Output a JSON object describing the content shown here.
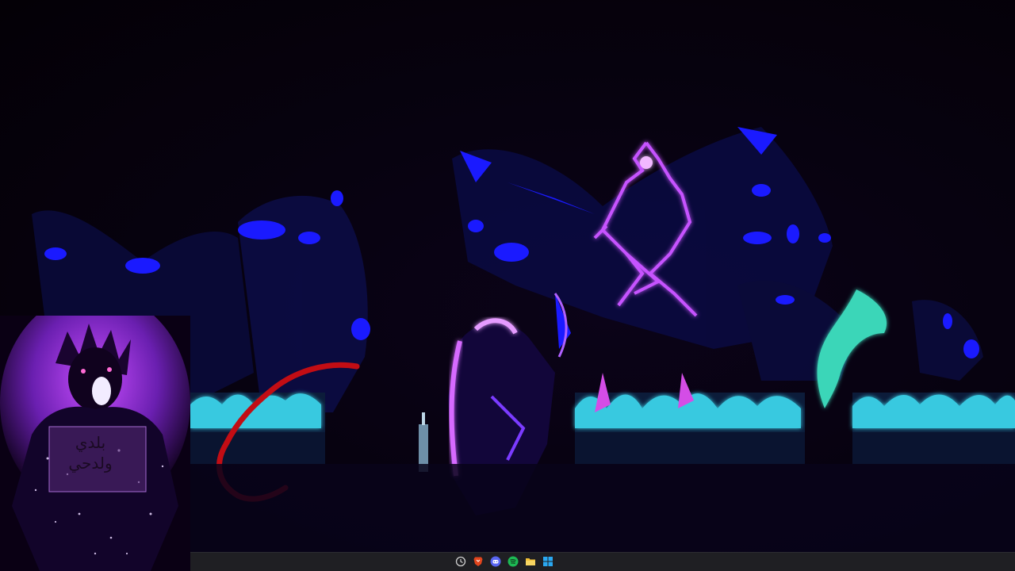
{
  "overlay": {
    "sign_line_1": "بلدي",
    "sign_line_2": "ولدحي"
  },
  "taskbar": {
    "apps": [
      {
        "name": "clock-app",
        "icon": "clock-icon",
        "color": "#cfcfcf"
      },
      {
        "name": "brave-browser",
        "icon": "brave-lion-icon",
        "color": "#e2451d"
      },
      {
        "name": "discord",
        "icon": "discord-icon",
        "color": "#5865f2"
      },
      {
        "name": "spotify",
        "icon": "spotify-icon",
        "color": "#1db954"
      },
      {
        "name": "file-explorer",
        "icon": "folder-icon",
        "color": "#f2c037"
      },
      {
        "name": "windows-store",
        "icon": "windows-icon",
        "color": "#2aa8f2"
      }
    ]
  },
  "colors": {
    "background": "#050008",
    "neon_blue": "#1a1aff",
    "neon_violet": "#c653ff",
    "neon_cyan": "#40f0c8",
    "taskbar": "#1f1f23"
  }
}
